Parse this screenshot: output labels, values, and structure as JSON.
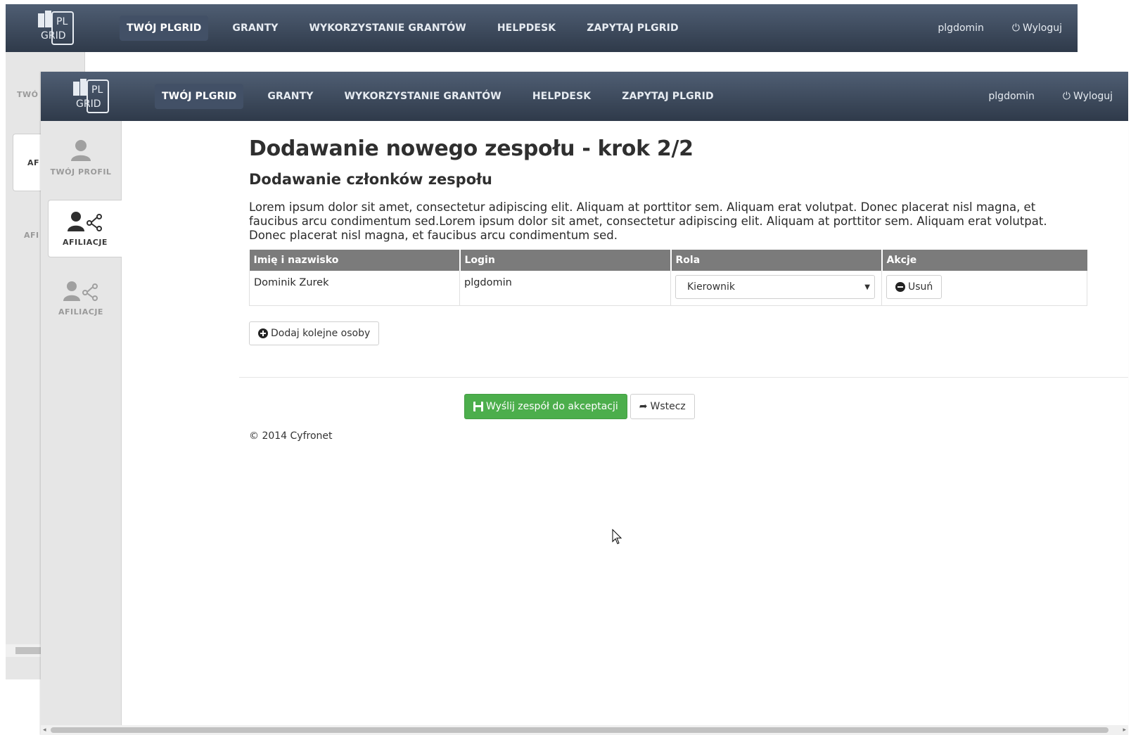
{
  "brand": {
    "logo_text_top": "PL",
    "logo_text_bottom": "GRID",
    "logo_plus": "+"
  },
  "nav": {
    "items": [
      {
        "label": "TWÓJ PLGRID",
        "active": true
      },
      {
        "label": "GRANTY"
      },
      {
        "label": "WYKORZYSTANIE GRANTÓW"
      },
      {
        "label": "HELPDESK"
      },
      {
        "label": "ZAPYTAJ PLGRID"
      }
    ],
    "username": "plgdomin",
    "logout_label": "Wyloguj"
  },
  "back_sidebar": {
    "items": [
      {
        "label": "TWÓ"
      },
      {
        "label": "AF"
      },
      {
        "label": "AFI"
      }
    ]
  },
  "sidebar": {
    "items": [
      {
        "label": "TWÓJ PROFIL",
        "icon": "user-icon"
      },
      {
        "label": "AFILIACJE",
        "icon": "user-share-icon",
        "active": true
      },
      {
        "label": "AFILIACJE",
        "icon": "user-share-icon"
      }
    ]
  },
  "page": {
    "title": "Dodawanie nowego zespołu - krok 2/2",
    "subtitle": "Dodawanie członków zespołu",
    "description": "Lorem ipsum dolor sit amet, consectetur adipiscing elit. Aliquam at porttitor sem. Aliquam erat volutpat. Donec placerat nisl magna, et faucibus arcu condimentum sed.Lorem ipsum dolor sit amet, consectetur adipiscing elit. Aliquam at porttitor sem. Aliquam erat volutpat. Donec placerat nisl magna, et faucibus arcu condimentum sed."
  },
  "table": {
    "headers": [
      "Imię i nazwisko",
      "Login",
      "Rola",
      "Akcje"
    ],
    "rows": [
      {
        "name": "Dominik Zurek",
        "login": "plgdomin",
        "role": "Kierownik",
        "action": "Usuń"
      }
    ]
  },
  "buttons": {
    "add_more": "Dodaj kolejne osoby",
    "submit": "Wyślij zespół do akceptacji",
    "back": "Wstecz"
  },
  "footer": {
    "copyright": "© 2014 Cyfronet"
  },
  "colors": {
    "navbar": "#3a4657",
    "success": "#4cae4c",
    "table_header": "#7b7b7b"
  }
}
